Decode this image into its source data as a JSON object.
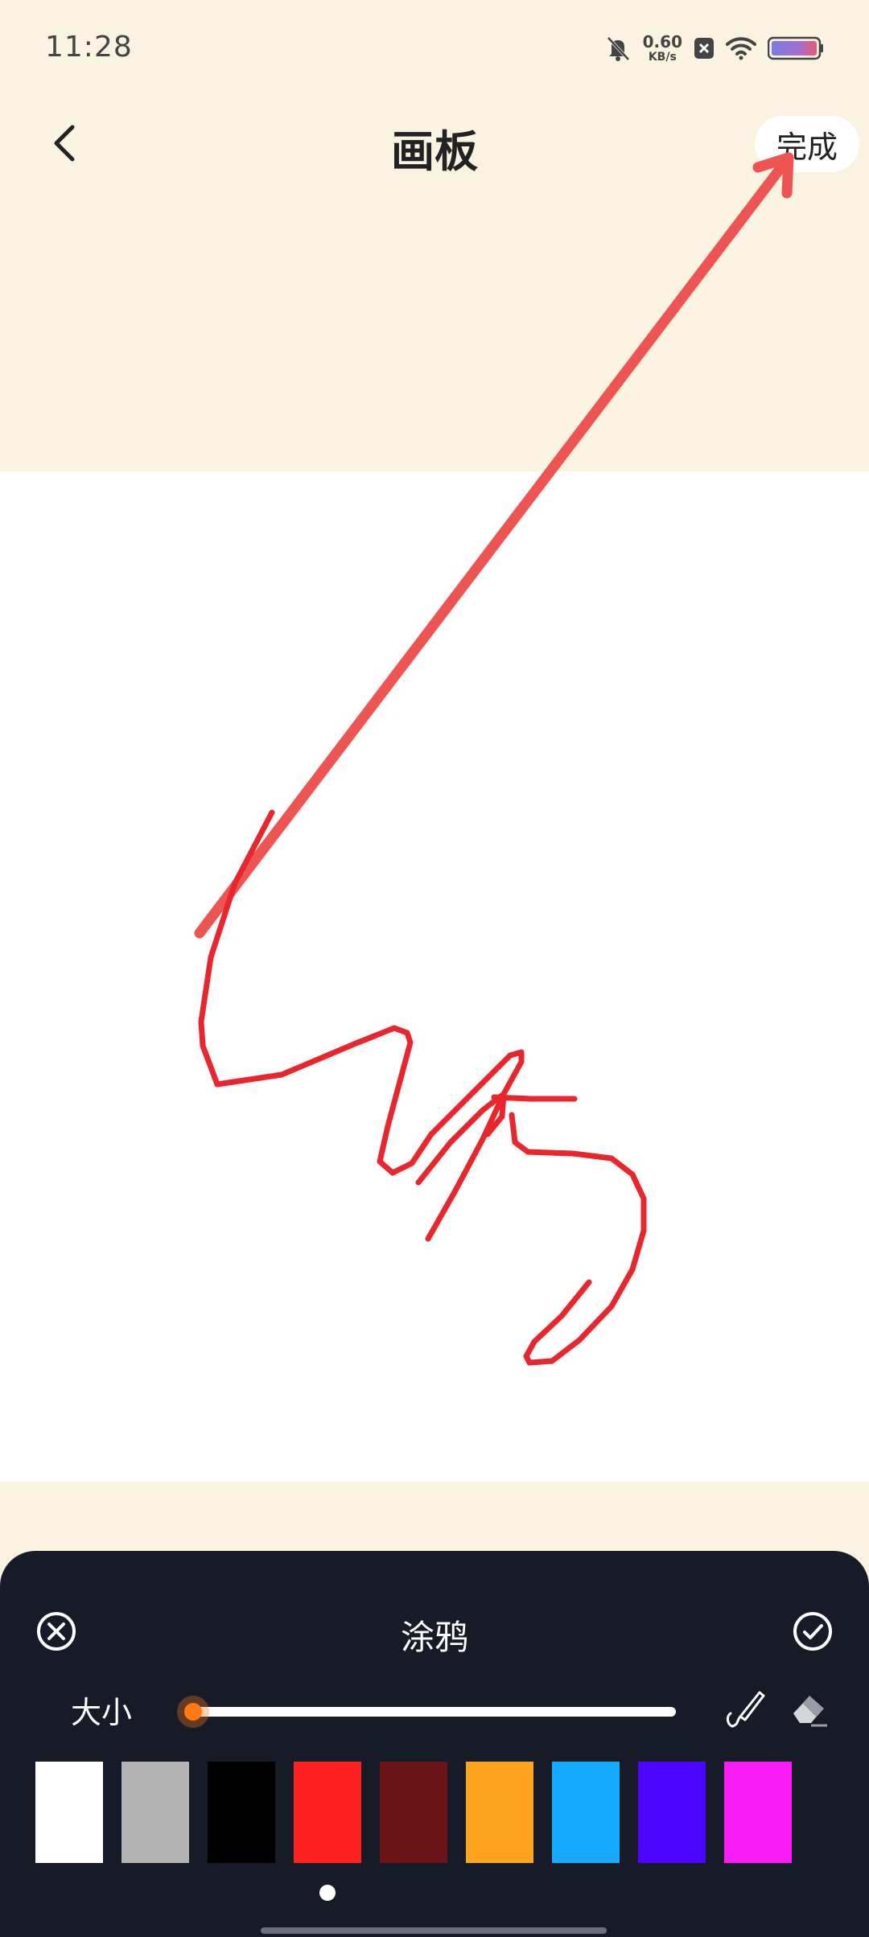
{
  "status_bar": {
    "time": "11:28",
    "net_speed_value": "0.60",
    "net_speed_unit": "KB/s",
    "icons": [
      "mute-bell-icon",
      "notification-x-icon",
      "wifi-icon",
      "battery-icon"
    ]
  },
  "header": {
    "title": "画板",
    "done_label": "完成",
    "back_icon": "chevron-left-icon"
  },
  "canvas": {
    "background_color": "#FFFFFF",
    "stroke_color": "#E8262B"
  },
  "panel": {
    "title": "涂鸦",
    "size_label": "大小",
    "size_value_fraction": 0.0,
    "tools": [
      "brush-icon",
      "eraser-icon"
    ],
    "palette": [
      {
        "name": "white",
        "color": "#FFFFFF"
      },
      {
        "name": "gray",
        "color": "#B3B3B3"
      },
      {
        "name": "black",
        "color": "#000000"
      },
      {
        "name": "red",
        "color": "#FF2121"
      },
      {
        "name": "dark-red",
        "color": "#6A1418"
      },
      {
        "name": "orange",
        "color": "#FFA41C"
      },
      {
        "name": "sky-blue",
        "color": "#17A9FF"
      },
      {
        "name": "violet",
        "color": "#4C06FF"
      },
      {
        "name": "magenta",
        "color": "#F81CF6"
      }
    ],
    "page_indicator": {
      "current": 1,
      "total": 1
    }
  }
}
